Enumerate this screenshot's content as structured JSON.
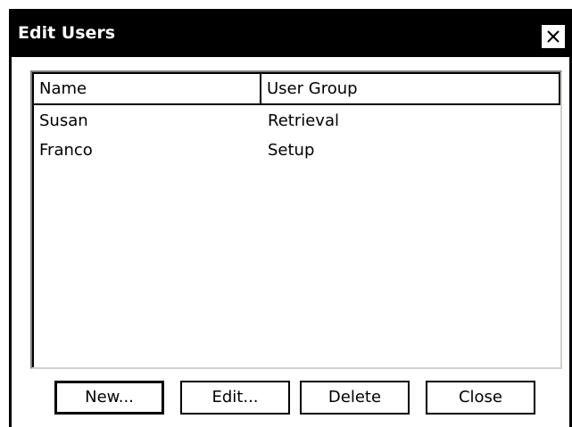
{
  "window": {
    "title": "Edit Users",
    "close_glyph": "✕"
  },
  "table": {
    "columns": [
      "Name",
      "User Group"
    ],
    "rows": [
      {
        "name": "Susan",
        "group": "Retrieval"
      },
      {
        "name": "Franco",
        "group": "Setup"
      }
    ]
  },
  "buttons": {
    "new": "New...",
    "edit": "Edit...",
    "delete": "Delete",
    "close": "Close"
  }
}
